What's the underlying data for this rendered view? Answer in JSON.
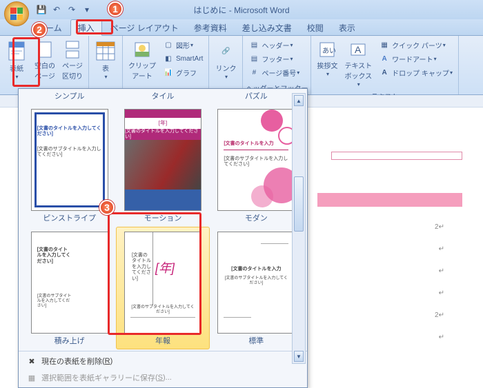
{
  "titlebar": {
    "document": "はじめに",
    "app": "Microsoft Word"
  },
  "tabs": [
    "ホーム",
    "挿入",
    "ページ レイアウト",
    "参考資料",
    "差し込み文書",
    "校閲",
    "表示"
  ],
  "active_tab_index": 1,
  "ribbon": {
    "cover_btn": "表紙",
    "blank_page": "空白の\nページ",
    "page_break": "ページ\n区切り",
    "table": "表",
    "clipart": "クリップ\nアート",
    "shapes": "図形",
    "smartart": "SmartArt",
    "chart": "グラフ",
    "link": "リンク",
    "header": "ヘッダー",
    "footer": "フッター",
    "page_number": "ページ番号",
    "group_hf_title": "ヘッダーとフッター",
    "aisatsu": "挨拶文",
    "textbox": "テキスト\nボックス",
    "quickparts": "クイック パーツ",
    "wordart": "ワードアート",
    "dropcap": "ドロップ キャップ",
    "group_text_title": "テキスト"
  },
  "gallery": {
    "top_titles": [
      "シンプル",
      "タイル",
      "パズル"
    ],
    "row1_names": [
      "ピンストライプ",
      "モーション",
      "モダン"
    ],
    "row2_names": [
      "積み上げ",
      "年報",
      "標準"
    ],
    "selected_index": 4,
    "thumb_title_text": "[文書のタイトルを入力してください]",
    "thumb_sub_text": "[文書のサブタイトルを入力してください]",
    "thumb_year": "[年]",
    "thumb_title_short": "[文書のタイトルを入力",
    "menu_delete": "現在の表紙を削除",
    "menu_delete_key": "R",
    "menu_save": "選択範囲を表紙ギャラリーに保存",
    "menu_save_key": "S"
  },
  "paragraph_marks": [
    "2↵",
    "↵",
    "↵",
    "↵",
    "2↵",
    "↵"
  ]
}
